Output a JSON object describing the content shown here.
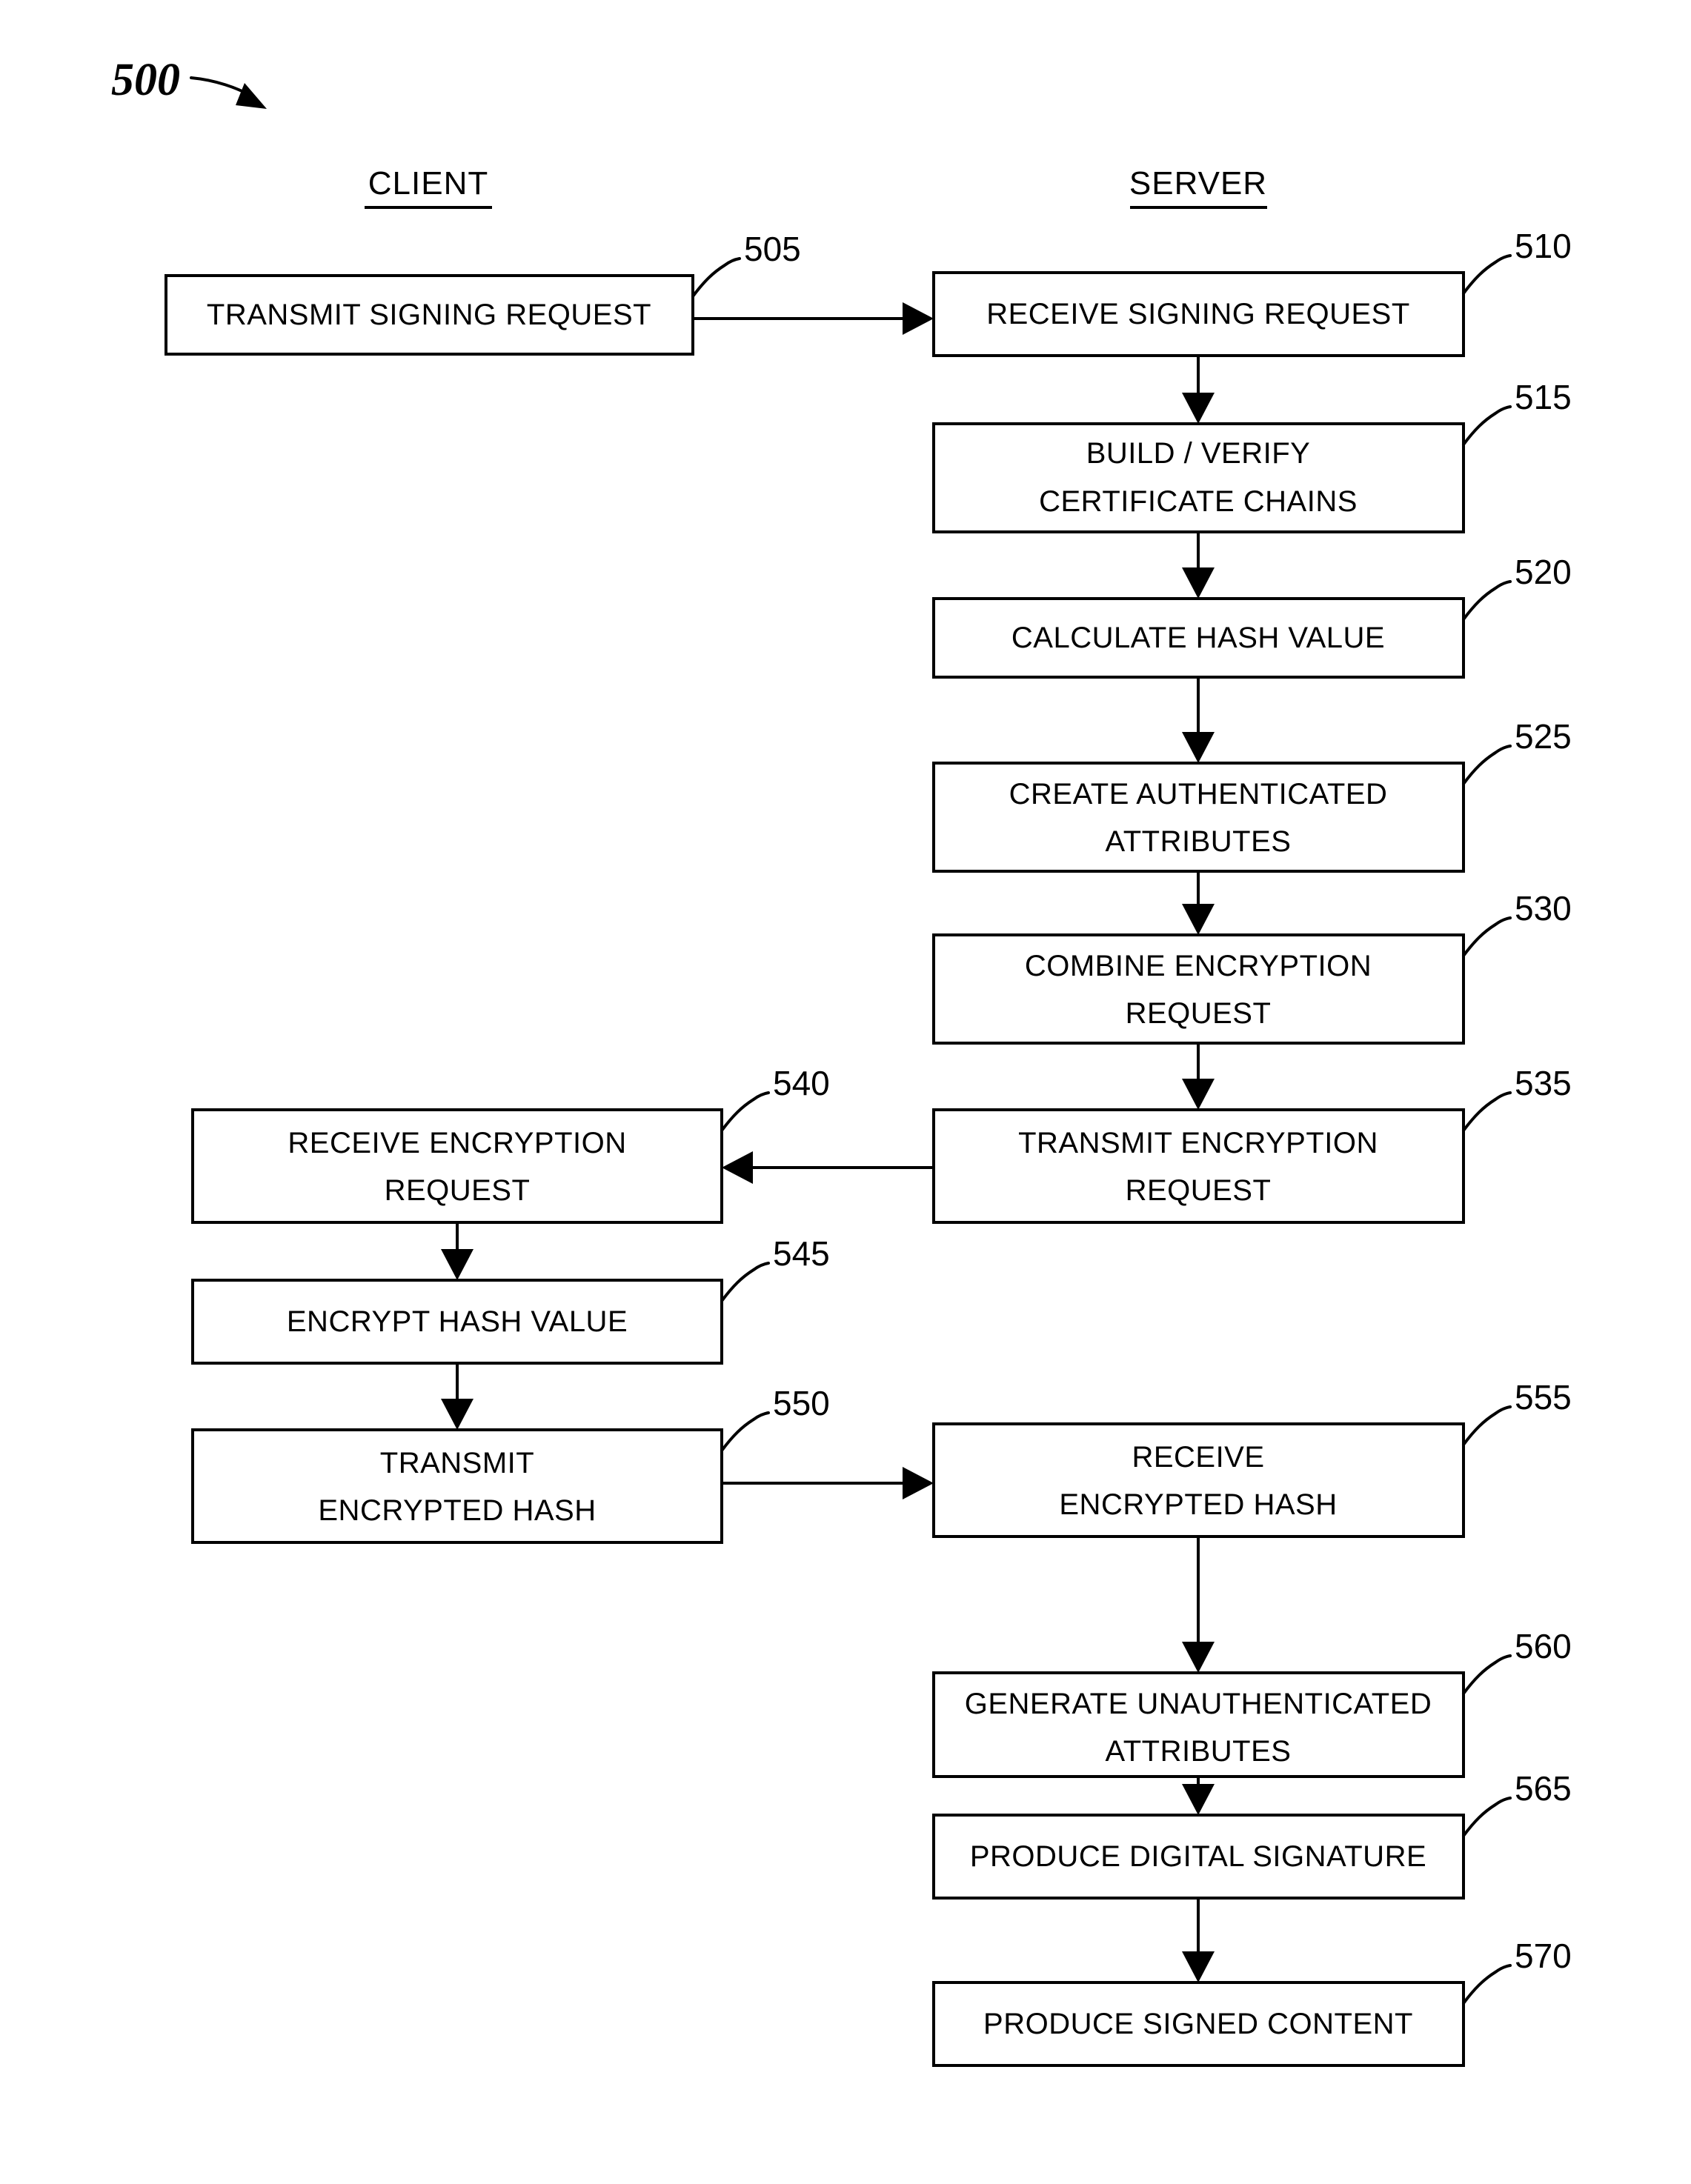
{
  "figure": {
    "number": "500"
  },
  "columns": [
    {
      "name": "client",
      "label": "CLIENT"
    },
    {
      "name": "server",
      "label": "SERVER"
    }
  ],
  "steps": [
    {
      "ref": "505",
      "column": "client",
      "lines": [
        "TRANSMIT SIGNING REQUEST"
      ]
    },
    {
      "ref": "510",
      "column": "server",
      "lines": [
        "RECEIVE SIGNING REQUEST"
      ]
    },
    {
      "ref": "515",
      "column": "server",
      "lines": [
        "BUILD / VERIFY",
        "CERTIFICATE CHAINS"
      ]
    },
    {
      "ref": "520",
      "column": "server",
      "lines": [
        "CALCULATE HASH VALUE"
      ]
    },
    {
      "ref": "525",
      "column": "server",
      "lines": [
        "CREATE AUTHENTICATED",
        "ATTRIBUTES"
      ]
    },
    {
      "ref": "530",
      "column": "server",
      "lines": [
        "COMBINE ENCRYPTION",
        "REQUEST"
      ]
    },
    {
      "ref": "535",
      "column": "server",
      "lines": [
        "TRANSMIT ENCRYPTION",
        "REQUEST"
      ]
    },
    {
      "ref": "540",
      "column": "client",
      "lines": [
        "RECEIVE ENCRYPTION",
        "REQUEST"
      ]
    },
    {
      "ref": "545",
      "column": "client",
      "lines": [
        "ENCRYPT HASH VALUE"
      ]
    },
    {
      "ref": "550",
      "column": "client",
      "lines": [
        "TRANSMIT",
        "ENCRYPTED HASH"
      ]
    },
    {
      "ref": "555",
      "column": "server",
      "lines": [
        "RECEIVE",
        "ENCRYPTED HASH"
      ]
    },
    {
      "ref": "560",
      "column": "server",
      "lines": [
        "GENERATE UNAUTHENTICATED",
        "ATTRIBUTES"
      ]
    },
    {
      "ref": "565",
      "column": "server",
      "lines": [
        "PRODUCE DIGITAL SIGNATURE"
      ]
    },
    {
      "ref": "570",
      "column": "server",
      "lines": [
        "PRODUCE SIGNED CONTENT"
      ]
    }
  ],
  "flows": [
    {
      "from": "505",
      "to": "510",
      "direction": "right"
    },
    {
      "from": "510",
      "to": "515",
      "direction": "down"
    },
    {
      "from": "515",
      "to": "520",
      "direction": "down"
    },
    {
      "from": "520",
      "to": "525",
      "direction": "down"
    },
    {
      "from": "525",
      "to": "530",
      "direction": "down"
    },
    {
      "from": "530",
      "to": "535",
      "direction": "down"
    },
    {
      "from": "535",
      "to": "540",
      "direction": "left"
    },
    {
      "from": "540",
      "to": "545",
      "direction": "down"
    },
    {
      "from": "545",
      "to": "550",
      "direction": "down"
    },
    {
      "from": "550",
      "to": "555",
      "direction": "right"
    },
    {
      "from": "555",
      "to": "560",
      "direction": "down"
    },
    {
      "from": "560",
      "to": "565",
      "direction": "down"
    },
    {
      "from": "565",
      "to": "570",
      "direction": "down"
    }
  ],
  "colors": {
    "ink": "#000000",
    "paper": "#ffffff"
  }
}
